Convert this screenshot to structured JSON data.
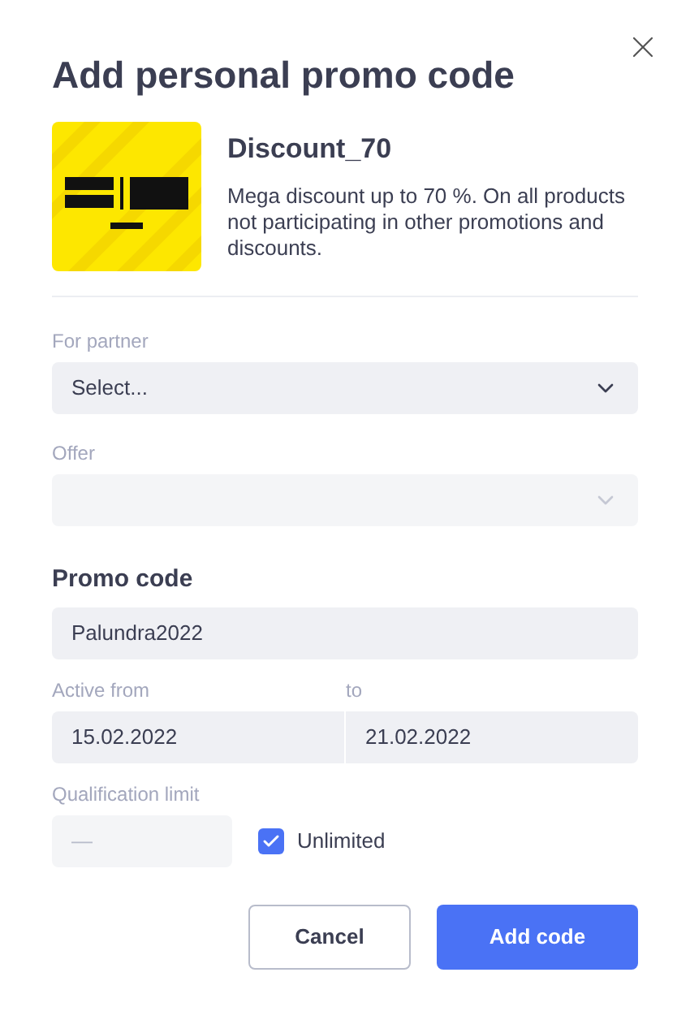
{
  "dialog": {
    "title": "Add personal promo code"
  },
  "promo": {
    "name": "Discount_70",
    "description": "Mega discount up to 70 %. On all products not participating in other promotions and discounts."
  },
  "partner": {
    "label": "For partner",
    "value": "Select...",
    "disabled": false
  },
  "offer": {
    "label": "Offer",
    "disabled": true
  },
  "promo_code": {
    "label": "Promo code",
    "value": "Palundra2022"
  },
  "active_from": {
    "label": "Active from",
    "value": "15.02.2022"
  },
  "active_to": {
    "label": "to",
    "value": "21.02.2022"
  },
  "qualification_limit": {
    "label": "Qualification limit",
    "placeholder": "—",
    "disabled": true,
    "unlimited": {
      "label": "Unlimited",
      "checked": true
    }
  },
  "buttons": [
    {
      "kind": "secondary",
      "label": "Cancel"
    },
    {
      "kind": "primary",
      "label": "Add code"
    }
  ]
}
